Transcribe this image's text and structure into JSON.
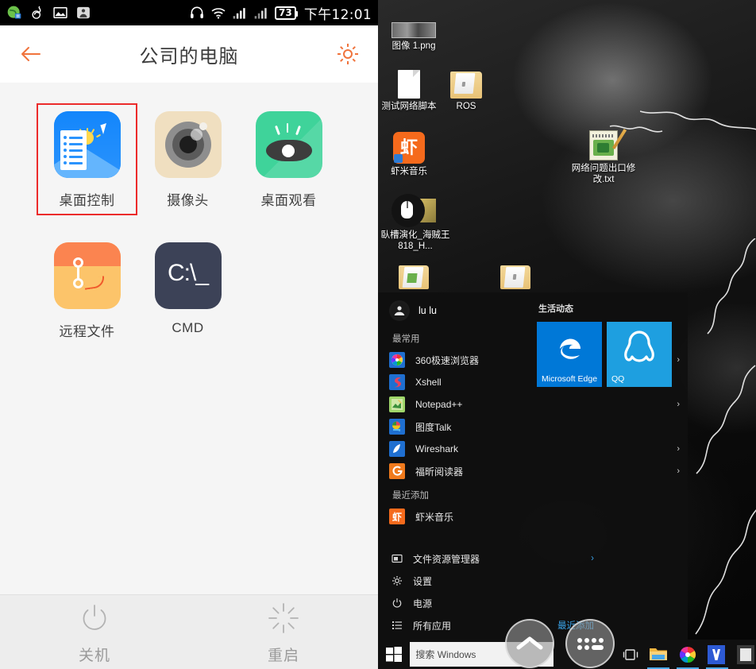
{
  "phone": {
    "statusbar": {
      "icons": [
        "qq-browser-icon",
        "netease-music-icon",
        "gallery-icon",
        "contact-icon",
        "headphone-icon",
        "wifi-icon",
        "signal-1-icon",
        "signal-2-icon"
      ],
      "battery": "73",
      "time": "下午12:01"
    },
    "appbar": {
      "back_icon": "back-arrow-icon",
      "title": "公司的电脑",
      "settings_icon": "gear-icon"
    },
    "apps": [
      {
        "id": "desktop-control",
        "label": "桌面控制",
        "icon": "desktop-control-icon",
        "selected": true
      },
      {
        "id": "camera",
        "label": "摄像头",
        "icon": "camera-icon",
        "selected": false
      },
      {
        "id": "desktop-view",
        "label": "桌面观看",
        "icon": "eye-icon",
        "selected": false
      },
      {
        "id": "remote-files",
        "label": "远程文件",
        "icon": "remote-files-icon",
        "selected": false
      },
      {
        "id": "cmd",
        "label": "CMD",
        "icon": "cmd-icon",
        "selected": false
      }
    ],
    "cmd_icon_text": "C:\\_",
    "bottom": [
      {
        "id": "shutdown",
        "label": "关机",
        "icon": "power-icon"
      },
      {
        "id": "restart",
        "label": "重启",
        "icon": "restart-icon"
      }
    ],
    "colors": {
      "accent": "#f0733c",
      "selection": "#ec2b2b",
      "bg": "#f5f5f5"
    }
  },
  "windows": {
    "desktop_icons": [
      {
        "label": "图像 1.png",
        "icon": "image-file-icon"
      },
      {
        "label": "测试网络脚本",
        "icon": "document-file-icon"
      },
      {
        "label": "ROS",
        "icon": "folder-icon"
      },
      {
        "label": "虾米音乐",
        "icon": "xiami-music-icon"
      },
      {
        "label": "网络问题出口修改.txt",
        "icon": "notepad-file-icon"
      },
      {
        "label": "臥槽演化_海贼王818_H...",
        "icon": "video-file-icon"
      }
    ],
    "startmenu": {
      "user": "lu lu",
      "user_avatar_icon": "user-avatar-icon",
      "most_used_header": "最常用",
      "most_used": [
        {
          "label": "360极速浏览器",
          "icon": "360-browser-icon",
          "chevron": "›"
        },
        {
          "label": "Xshell",
          "icon": "xshell-icon",
          "chevron": ""
        },
        {
          "label": "Notepad++",
          "icon": "notepad-plus-icon",
          "chevron": "›"
        },
        {
          "label": "图度Talk",
          "icon": "tudou-talk-icon",
          "chevron": ""
        },
        {
          "label": "Wireshark",
          "icon": "wireshark-icon",
          "chevron": "›"
        },
        {
          "label": "福昕阅读器",
          "icon": "foxit-reader-icon",
          "chevron": "›"
        }
      ],
      "recent_header": "最近添加",
      "recent": [
        {
          "label": "虾米音乐",
          "icon": "xiami-music-icon"
        }
      ],
      "bottom_rows": [
        {
          "label": "文件资源管理器",
          "icon": "file-explorer-icon",
          "chevron": "›",
          "badge": ""
        },
        {
          "label": "设置",
          "icon": "settings-gear-icon",
          "chevron": "",
          "badge": ""
        },
        {
          "label": "电源",
          "icon": "power-icon",
          "chevron": "",
          "badge": ""
        },
        {
          "label": "所有应用",
          "icon": "all-apps-icon",
          "chevron": "",
          "badge": "最近添加"
        }
      ],
      "tiles_header": "生活动态",
      "tiles": [
        {
          "label": "Microsoft Edge",
          "icon": "edge-icon",
          "color": "#0078d7"
        },
        {
          "label": "QQ",
          "icon": "qq-icon",
          "color": "#1e9fe0"
        }
      ]
    },
    "taskbar": {
      "start_icon": "windows-start-icon",
      "search_placeholder": "搜索 Windows",
      "taskview_icon": "task-view-icon",
      "pinned": [
        {
          "icon": "file-explorer-icon",
          "name": "file-explorer"
        },
        {
          "icon": "360-browser-icon",
          "name": "360-browser"
        },
        {
          "icon": "wps-icon",
          "name": "wps"
        },
        {
          "icon": "app-icon",
          "name": "pinned-app"
        }
      ]
    }
  },
  "android_nav": {
    "back_icon": "nav-up-chevron-icon",
    "apps_icon": "nav-apps-grid-icon"
  }
}
